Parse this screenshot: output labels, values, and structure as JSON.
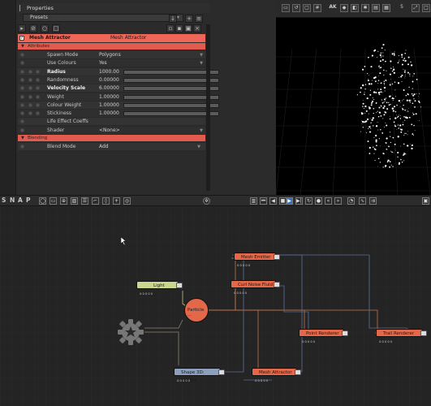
{
  "properties": {
    "title": "Properties",
    "presets_label": "Presets",
    "header": {
      "name": "Mesh Attractor",
      "type": "Mesh Attractor"
    },
    "sections": {
      "attributes": "Attributes",
      "blending": "Blending"
    },
    "rows": [
      {
        "label": "Spawn Mode",
        "value": "Polygons",
        "kind": "dropdown"
      },
      {
        "label": "Use Colours",
        "value": "Yes",
        "kind": "dropdown"
      },
      {
        "label": "Radius",
        "value": "1000.00",
        "kind": "slider",
        "bold": true
      },
      {
        "label": "Randomness",
        "value": "0.00000",
        "kind": "slider"
      },
      {
        "label": "Velocity Scale",
        "value": "6.00000",
        "kind": "slider",
        "bold": true
      },
      {
        "label": "Weight",
        "value": "1.00000",
        "kind": "slider"
      },
      {
        "label": "Colour Weight",
        "value": "1.00000",
        "kind": "slider"
      },
      {
        "label": "Stickiness",
        "value": "1.00000",
        "kind": "slider"
      },
      {
        "label": "Life Effect Coeffs",
        "value": "",
        "kind": "none"
      },
      {
        "label": "Shader",
        "value": "<None>",
        "kind": "dropdown"
      }
    ],
    "blend_mode": {
      "label": "Blend Mode",
      "value": "Add"
    },
    "icons": [
      "down-arrow-icon",
      "add-icon",
      "menu-icon",
      "copy-icon",
      "paste-icon",
      "save-icon",
      "delete-icon"
    ]
  },
  "viewport": {
    "toolbar_counter": "5",
    "toolbar_label": "AK"
  },
  "snap": {
    "letters": [
      "S",
      "N",
      "A",
      "P"
    ]
  },
  "graph": {
    "nodes": {
      "mesh_emitter": "Mesh Emitter",
      "curl_noise": "Curl Noise Fluid ...",
      "light": "Light",
      "particle": "Particle ...",
      "point_renderer": "Point Renderer",
      "trail_renderer": "Trail Renderer",
      "shape_sphere": "Shape 3D: Sphere",
      "mesh_attractor": "Mesh Attractor"
    },
    "colors": {
      "emitter": "#e3684a",
      "light": "#c9d78c",
      "shape": "#8c9fbc",
      "wire_orange": "#c0734a",
      "wire_blue": "#5a6f9a"
    }
  }
}
